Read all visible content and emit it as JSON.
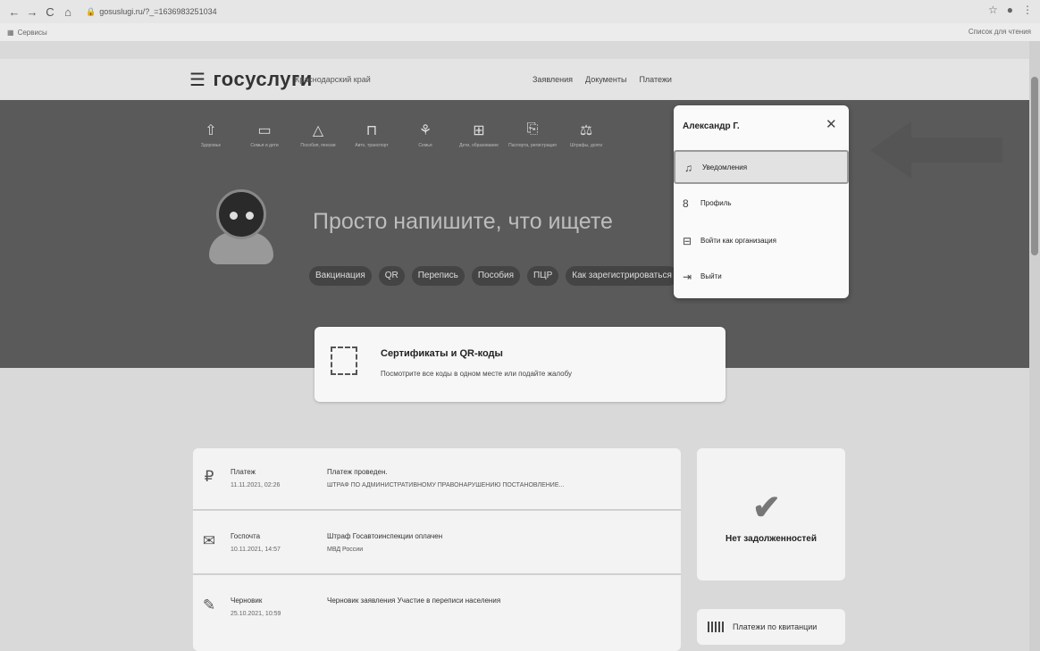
{
  "browser": {
    "nav": [
      "←",
      "→",
      "C",
      "⌂"
    ],
    "url": "gosuslugi.ru/?_=1636983251034",
    "bookmarks_label": "Сервисы",
    "reading_list": "Список для чтения",
    "icons": [
      "star-icon",
      "profile-icon",
      "kebab-menu-icon"
    ]
  },
  "header": {
    "logo": "госуслуги",
    "region": "Краснодарский край",
    "nav": [
      "Заявления",
      "Документы",
      "Платежи"
    ]
  },
  "hero": {
    "categories": [
      {
        "icon": "gift-icon",
        "label": "Здоровье"
      },
      {
        "icon": "folder-icon",
        "label": "Семья и дети"
      },
      {
        "icon": "bell-icon",
        "label": "Пособия, пенсии"
      },
      {
        "icon": "car-icon",
        "label": "Авто, транспорт"
      },
      {
        "icon": "tent-icon",
        "label": "Семья"
      },
      {
        "icon": "book-icon",
        "label": "Дети, образование"
      },
      {
        "icon": "document-icon",
        "label": "Паспорта, регистрация"
      },
      {
        "icon": "scales-icon",
        "label": "Штрафы, долги"
      }
    ],
    "search_placeholder": "Просто напишите, что ищете",
    "chips": [
      "Вакцинация",
      "QR",
      "Перепись",
      "Пособия",
      "ПЦР",
      "Как зарегистрироваться"
    ]
  },
  "certificate": {
    "title": "Сертификаты и QR-коды",
    "subtitle": "Посмотрите все коды в одном месте или подайте жалобу"
  },
  "feed": [
    {
      "icon": "ruble-icon",
      "glyph": "₽",
      "kind": "Платеж",
      "date": "11.11.2021, 02:26",
      "headline": "Платеж проведен.",
      "detail": "ШТРАФ ПО АДМИНИСТРАТИВНОМУ ПРАВОНАРУШЕНИЮ ПОСТАНОВЛЕНИЕ..."
    },
    {
      "icon": "mail-icon",
      "glyph": "✉",
      "kind": "Госпочта",
      "date": "10.11.2021, 14:57",
      "headline": "Штраф Госавтоинспекции оплачен",
      "detail": "МВД России"
    },
    {
      "icon": "pencil-icon",
      "glyph": "✎",
      "kind": "Черновик",
      "date": "25.10.2021, 10:59",
      "headline": "Черновик заявления Участие в переписи населения",
      "detail": ""
    }
  ],
  "debt": {
    "status": "Нет задолженностей"
  },
  "receipts": {
    "label": "Платежи по квитанции"
  },
  "user_menu": {
    "user_name": "Александр Г.",
    "close": "✕",
    "items": [
      {
        "icon": "bell-icon",
        "glyph": "♫",
        "label": "Уведомления"
      },
      {
        "icon": "person-icon",
        "glyph": "8",
        "label": "Профиль"
      },
      {
        "icon": "briefcase-icon",
        "glyph": "⊟",
        "label": "Войти как организация"
      },
      {
        "icon": "logout-icon",
        "glyph": "⇥",
        "label": "Выйти"
      }
    ]
  },
  "colors": {
    "hero_bg": "#5a5a5a",
    "card_bg": "#f3f3f3",
    "arrow": "#555555"
  }
}
